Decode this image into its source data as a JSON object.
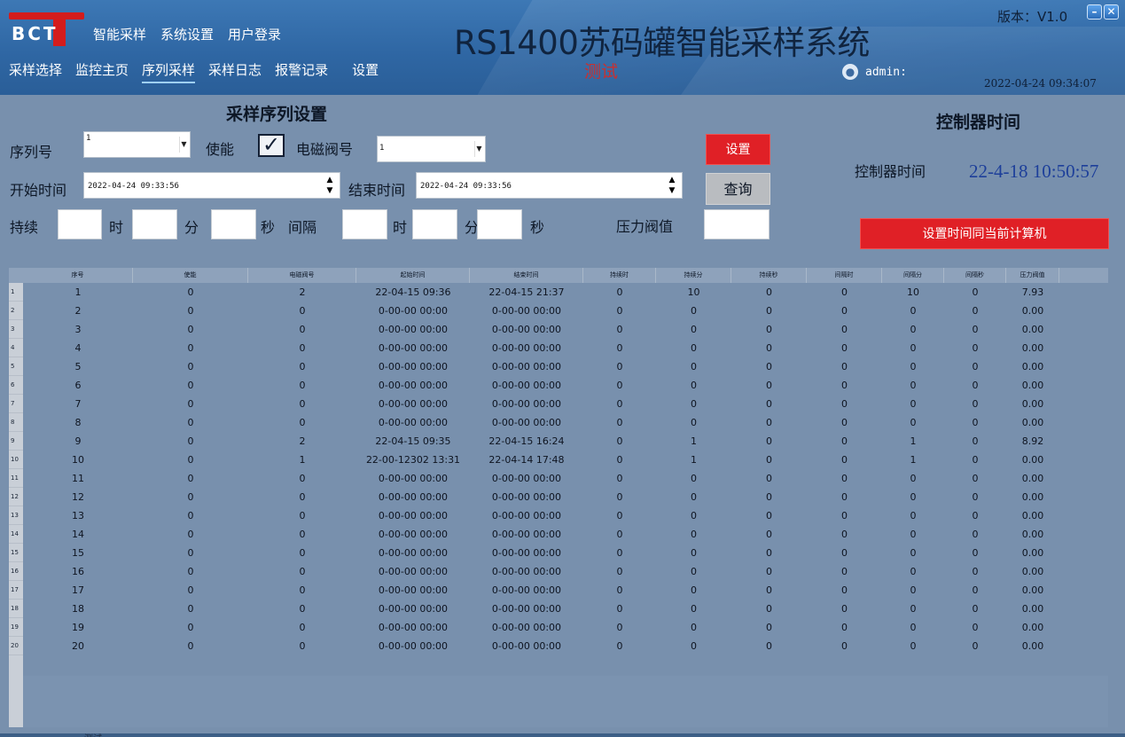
{
  "header": {
    "logo_text": "BCT",
    "top_menu": [
      "智能采样",
      "系统设置",
      "用户登录"
    ],
    "nav_tabs": [
      {
        "label": "采样选择",
        "active": false
      },
      {
        "label": "监控主页",
        "active": false
      },
      {
        "label": "序列采样",
        "active": true
      },
      {
        "label": "采样日志",
        "active": false
      },
      {
        "label": "报警记录",
        "active": false
      },
      {
        "label": "设置",
        "active": false
      }
    ],
    "title": "RS1400苏码罐智能采样系统",
    "subtitle": "测试",
    "version": "版本：V1.0",
    "user": "admin:",
    "datetime": "2022-04-24 09:34:07"
  },
  "form": {
    "section_title": "采样序列设置",
    "seq_label": "序列号",
    "seq_value": "1",
    "enable_label": "使能",
    "enable_checked": true,
    "valve_label": "电磁阀号",
    "valve_value": "1",
    "start_label": "开始时间",
    "start_value": "2022-04-24 09:33:56",
    "end_label": "结束时间",
    "end_value": "2022-04-24 09:33:56",
    "duration_label": "持续",
    "hour_label": "时",
    "minute_label": "分",
    "second_label": "秒",
    "interval_label": "间隔",
    "pressure_label": "压力阀值",
    "set_button": "设置",
    "query_button": "查询"
  },
  "controller": {
    "title": "控制器时间",
    "label": "控制器时间",
    "value": "22-4-18 10:50:57",
    "sync_button": "设置时间同当前计算机"
  },
  "table": {
    "columns": [
      "序号",
      "使能",
      "电磁阀号",
      "起始时间",
      "结束时间",
      "持续时",
      "持续分",
      "持续秒",
      "间隔时",
      "间隔分",
      "间隔秒",
      "压力阀值"
    ],
    "rows": [
      [
        "1",
        "0",
        "2",
        "22-04-15 09:36",
        "22-04-15 21:37",
        "0",
        "10",
        "0",
        "0",
        "10",
        "0",
        "7.93"
      ],
      [
        "2",
        "0",
        "0",
        "0-00-00 00:00",
        "0-00-00 00:00",
        "0",
        "0",
        "0",
        "0",
        "0",
        "0",
        "0.00"
      ],
      [
        "3",
        "0",
        "0",
        "0-00-00 00:00",
        "0-00-00 00:00",
        "0",
        "0",
        "0",
        "0",
        "0",
        "0",
        "0.00"
      ],
      [
        "4",
        "0",
        "0",
        "0-00-00 00:00",
        "0-00-00 00:00",
        "0",
        "0",
        "0",
        "0",
        "0",
        "0",
        "0.00"
      ],
      [
        "5",
        "0",
        "0",
        "0-00-00 00:00",
        "0-00-00 00:00",
        "0",
        "0",
        "0",
        "0",
        "0",
        "0",
        "0.00"
      ],
      [
        "6",
        "0",
        "0",
        "0-00-00 00:00",
        "0-00-00 00:00",
        "0",
        "0",
        "0",
        "0",
        "0",
        "0",
        "0.00"
      ],
      [
        "7",
        "0",
        "0",
        "0-00-00 00:00",
        "0-00-00 00:00",
        "0",
        "0",
        "0",
        "0",
        "0",
        "0",
        "0.00"
      ],
      [
        "8",
        "0",
        "0",
        "0-00-00 00:00",
        "0-00-00 00:00",
        "0",
        "0",
        "0",
        "0",
        "0",
        "0",
        "0.00"
      ],
      [
        "9",
        "0",
        "2",
        "22-04-15 09:35",
        "22-04-15 16:24",
        "0",
        "1",
        "0",
        "0",
        "1",
        "0",
        "8.92"
      ],
      [
        "10",
        "0",
        "1",
        "22-00-12302 13:31",
        "22-04-14 17:48",
        "0",
        "1",
        "0",
        "0",
        "1",
        "0",
        "0.00"
      ],
      [
        "11",
        "0",
        "0",
        "0-00-00 00:00",
        "0-00-00 00:00",
        "0",
        "0",
        "0",
        "0",
        "0",
        "0",
        "0.00"
      ],
      [
        "12",
        "0",
        "0",
        "0-00-00 00:00",
        "0-00-00 00:00",
        "0",
        "0",
        "0",
        "0",
        "0",
        "0",
        "0.00"
      ],
      [
        "13",
        "0",
        "0",
        "0-00-00 00:00",
        "0-00-00 00:00",
        "0",
        "0",
        "0",
        "0",
        "0",
        "0",
        "0.00"
      ],
      [
        "14",
        "0",
        "0",
        "0-00-00 00:00",
        "0-00-00 00:00",
        "0",
        "0",
        "0",
        "0",
        "0",
        "0",
        "0.00"
      ],
      [
        "15",
        "0",
        "0",
        "0-00-00 00:00",
        "0-00-00 00:00",
        "0",
        "0",
        "0",
        "0",
        "0",
        "0",
        "0.00"
      ],
      [
        "16",
        "0",
        "0",
        "0-00-00 00:00",
        "0-00-00 00:00",
        "0",
        "0",
        "0",
        "0",
        "0",
        "0",
        "0.00"
      ],
      [
        "17",
        "0",
        "0",
        "0-00-00 00:00",
        "0-00-00 00:00",
        "0",
        "0",
        "0",
        "0",
        "0",
        "0",
        "0.00"
      ],
      [
        "18",
        "0",
        "0",
        "0-00-00 00:00",
        "0-00-00 00:00",
        "0",
        "0",
        "0",
        "0",
        "0",
        "0",
        "0.00"
      ],
      [
        "19",
        "0",
        "0",
        "0-00-00 00:00",
        "0-00-00 00:00",
        "0",
        "0",
        "0",
        "0",
        "0",
        "0",
        "0.00"
      ],
      [
        "20",
        "0",
        "0",
        "0-00-00 00:00",
        "0-00-00 00:00",
        "0",
        "0",
        "0",
        "0",
        "0",
        "0",
        "0.00"
      ]
    ]
  },
  "footer_text": "测试",
  "colors": {
    "header_bg": "#2f67a4",
    "body_bg": "#7890ad",
    "accent_red": "#e02026",
    "controller_time": "#1d3f9a",
    "subtitle_red": "#c83030"
  }
}
